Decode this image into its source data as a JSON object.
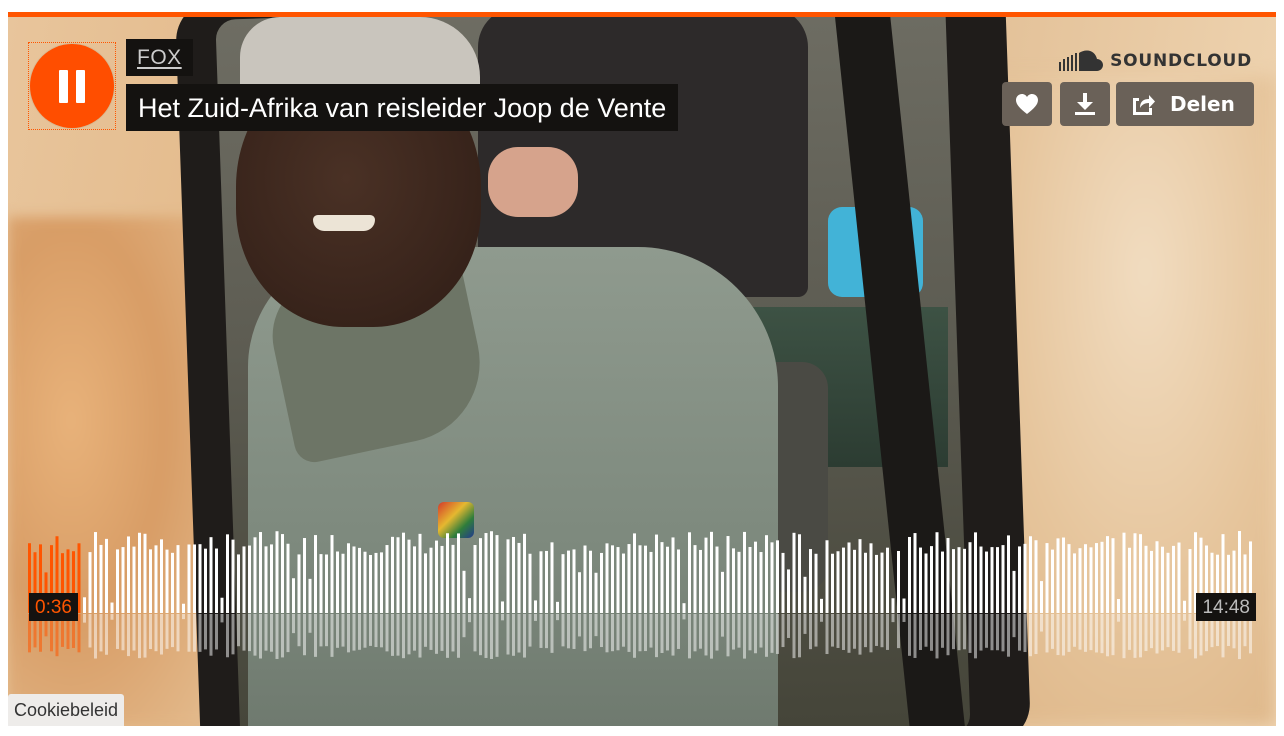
{
  "player": {
    "accent_color": "#ff5500",
    "artwork_alt_icon": "artwork-photo",
    "state": "playing",
    "artist": "FOX",
    "title": "Het Zuid-Afrika van reisleider Joop de Vente",
    "brand": "SOUNDCLOUD",
    "actions": {
      "like_icon": "heart-icon",
      "download_icon": "download-icon",
      "share_icon": "share-icon",
      "share_label": "Delen"
    },
    "current_time": "0:36",
    "duration": "14:48",
    "progress_fraction": 0.041,
    "played_color": "#ff5500",
    "unplayed_color": "#ffffff"
  },
  "footer": {
    "cookie_label": "Cookiebeleid"
  }
}
